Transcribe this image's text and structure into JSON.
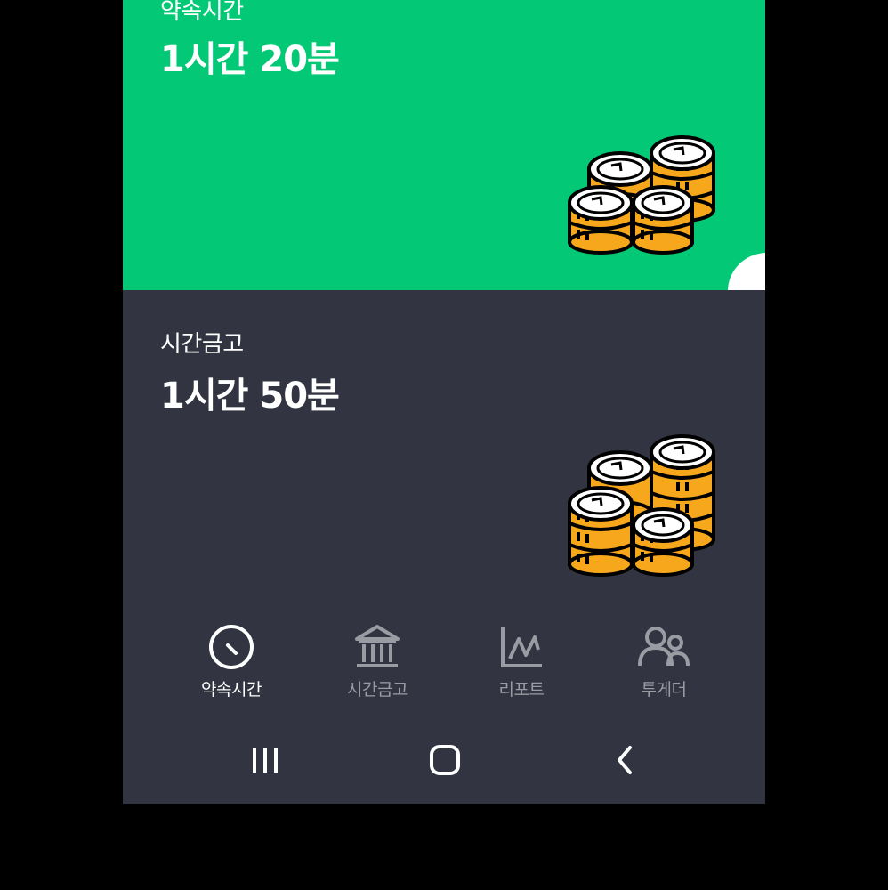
{
  "promise_card": {
    "label": "약속시간",
    "value": "1시간 20분",
    "bg_color": "#03C977"
  },
  "bank_card": {
    "label": "시간금고",
    "value": "1시간 50분",
    "bg_color": "#323541"
  },
  "bottom_nav": {
    "items": [
      {
        "label": "약속시간",
        "icon": "clock-icon",
        "active": true
      },
      {
        "label": "시간금고",
        "icon": "bank-icon",
        "active": false
      },
      {
        "label": "리포트",
        "icon": "chart-icon",
        "active": false
      },
      {
        "label": "투게더",
        "icon": "people-icon",
        "active": false
      }
    ],
    "active_color": "#ffffff",
    "inactive_color": "#9a9ca4"
  },
  "system_nav": {
    "icons": [
      "recent-apps-icon",
      "home-icon",
      "back-icon"
    ]
  }
}
